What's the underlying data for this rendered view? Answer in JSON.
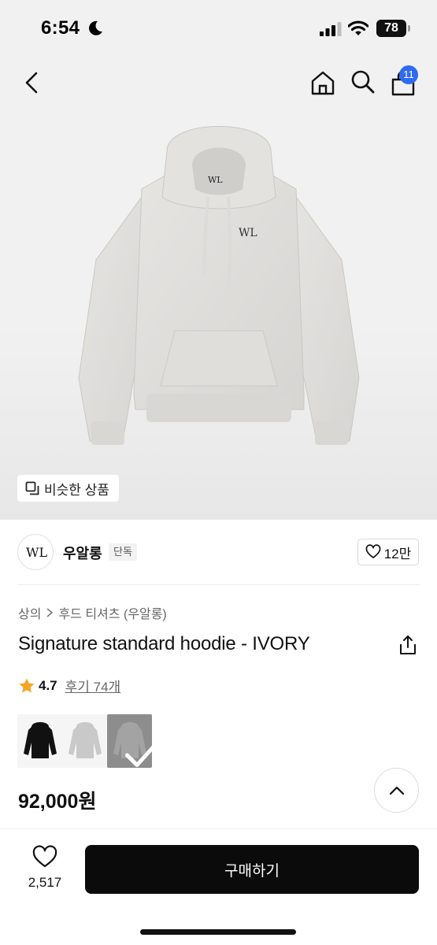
{
  "status_bar": {
    "time": "6:54",
    "battery": "78",
    "battery_fraction": 0.78
  },
  "nav": {
    "cart_badge": "11"
  },
  "hero": {
    "similar_products_label": "비슷한 상품"
  },
  "brand": {
    "name": "우알롱",
    "tag": "단독",
    "like_count": "12만"
  },
  "breadcrumb": {
    "category": "상의",
    "subcategory": "후드 티셔츠 (우알롱)"
  },
  "product": {
    "title": "Signature standard hoodie - IVORY",
    "rating": "4.7",
    "reviews_label": "후기 74개",
    "price": "92,000원"
  },
  "color_options": [
    {
      "name": "black-hoodie",
      "color": "#111111"
    },
    {
      "name": "gray-hoodie",
      "color": "#c9c9c9"
    },
    {
      "name": "ivory-hoodie",
      "color": "#8d8d8d",
      "selected": true
    }
  ],
  "bottom_bar": {
    "wish_count": "2,517",
    "buy_label": "구매하기"
  },
  "colors": {
    "accent_badge": "#2e6bf0",
    "star": "#f5a623",
    "buy_button": "#0b0b0b"
  }
}
